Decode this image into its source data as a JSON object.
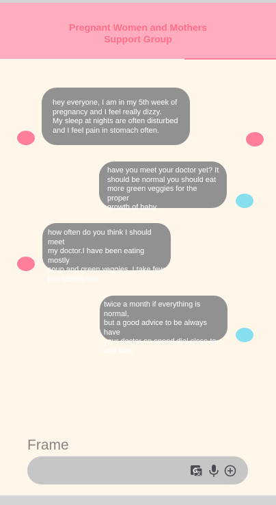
{
  "header": {
    "title": "Pregnant Women and Mothers\nSupport Group"
  },
  "messages": [
    {
      "sender": "other",
      "text": "hey everyone, I am in my 5th week of\npregnancy and I feel really dizzy.\nMy sleep at nights are often disturbed\nand I feel pain in stomach often."
    },
    {
      "sender": "self",
      "text": "have you  meet your doctor yet? It\nshould be normal you should eat\nmore green veggies for the proper\ngrowth of baby"
    },
    {
      "sender": "other",
      "text": "how often do you think I should meet\nmy doctor.I have been eating mostly\nsoup and green veggies. I take few\niron tablets too."
    },
    {
      "sender": "self",
      "text": "twice a month if everything is normal,\nbut a good advice to be always have\nyour doctor on speed dial close to\ndue date"
    }
  ],
  "composer": {
    "frame_label": "Frame",
    "icons": [
      "translate-icon",
      "microphone-icon",
      "add-circle-icon"
    ]
  },
  "colors": {
    "header": "#ffadbe",
    "title": "#ff6f8a",
    "background": "#fff6ea",
    "bubble": "#919191",
    "other_avatar": "#ff7f9a",
    "self_avatar": "#86dfee",
    "input_bar": "#c6c6c6"
  }
}
